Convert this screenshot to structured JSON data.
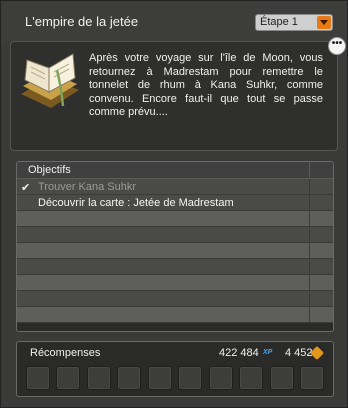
{
  "window": {
    "title": "L'empire de la jetée"
  },
  "step_select": {
    "selected": "Étape 1",
    "arrow_icon": "chevron-down-icon"
  },
  "description": {
    "text": "Après votre voyage sur l'île de Moon, vous retournez à Madrestam pour remettre le tonnelet de rhum à Kana Suhkr, comme convenu. Encore faut-il que tout se passe comme prévu....",
    "icon": "open-book-icon"
  },
  "more_button": {
    "label": "•••"
  },
  "objectives": {
    "header": "Objectifs",
    "items": [
      {
        "check": "✔",
        "label": "Trouver Kana Suhkr",
        "done": true
      },
      {
        "check": "",
        "label": "Découvrir la carte : Jetée de Madrestam",
        "done": false
      }
    ]
  },
  "rewards": {
    "title": "Récompenses",
    "xp_value": "422 484",
    "xp_label": "XP",
    "kamas_value": "4 452",
    "kamas_icon": "kamas-icon",
    "slot_count": 10
  },
  "colors": {
    "accent": "#e87a15",
    "xp": "#4aa3e8",
    "kamas": "#e2961b"
  }
}
